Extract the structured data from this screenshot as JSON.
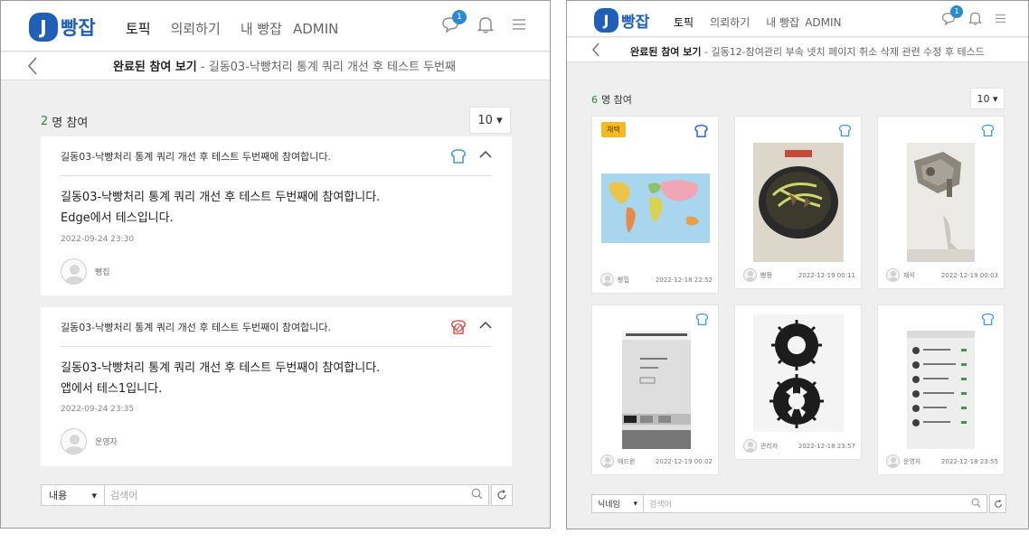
{
  "left": {
    "logo": {
      "badge": "J",
      "text": "빵잡"
    },
    "nav": [
      "토픽",
      "의뢰하기",
      "내 빵잡",
      "ADMIN"
    ],
    "message_badge": "1",
    "sub_title_bold": "완료된 참여 보기",
    "sub_title_rest": " - 길동03-낙빵처리 통계 쿼리 개선 후 테스트 두번째",
    "participant_count": "2",
    "participant_suffix": "명 참여",
    "page_size": "10 ▾",
    "entries": [
      {
        "title": "길동03-낙빵처리 통계 쿼리 개선 후 테스트 두번째에 참여합니다.",
        "body_line1": "길동03-낙빵처리 통계 쿼리 개선 후 테스트 두번째에 참여합니다.",
        "body_line2": "Edge에서 테스입니다.",
        "date": "2022-09-24 23:30",
        "user": "빵집",
        "icon": "bread-icon"
      },
      {
        "title": "길동03-낙빵처리 통계 쿼리 개선 후 테스트 두번째이 참여합니다.",
        "body_line1": "길동03-낙빵처리 통계 쿼리 개선 후 테스트 두번째이 참여합니다.",
        "body_line2": "앱에서 테스1입니다.",
        "date": "2022-09-24 23:35",
        "user": "운영자",
        "icon": "no-bread-icon"
      }
    ],
    "search": {
      "select": "내용",
      "placeholder": "검색어"
    }
  },
  "right": {
    "logo": {
      "badge": "J",
      "text": "빵잡"
    },
    "nav": [
      "토픽",
      "의뢰하기",
      "내 빵잡",
      "ADMIN"
    ],
    "message_badge": "1",
    "sub_title_bold": "완료된 참여 보기",
    "sub_title_rest": " - 길동12-참여관리 부속 넷치 페이지 취소 삭제 관련 수정 후 테스드",
    "participant_count": "6",
    "participant_suffix": "명 참여",
    "page_size": "10 ▾",
    "adopted_label": "채택",
    "cards": [
      {
        "user": "빵집",
        "date": "2022-12-18 22:52",
        "thumb": "world-map"
      },
      {
        "user": "빵짱",
        "date": "2022-12-19 00:11",
        "thumb": "food-bowl"
      },
      {
        "user": "재석",
        "date": "2022-12-19 00:03",
        "thumb": "machine-part"
      },
      {
        "user": "에드윈",
        "date": "2022-12-19 00:02",
        "thumb": "screen-photo"
      },
      {
        "user": "관리자",
        "date": "2022-12-18 23:57",
        "thumb": "gears"
      },
      {
        "user": "운영자",
        "date": "2022-12-18 23:55",
        "thumb": "app-list"
      }
    ],
    "search": {
      "select": "닉네임",
      "placeholder": "검색어"
    }
  },
  "colors": {
    "brand": "#1f5fb8",
    "badge": "#2a8ad4",
    "count": "#2b8a3e",
    "adopted": "#f5b921",
    "bread_icon": "#3a9ad6",
    "no_bread_icon": "#d9534f"
  }
}
